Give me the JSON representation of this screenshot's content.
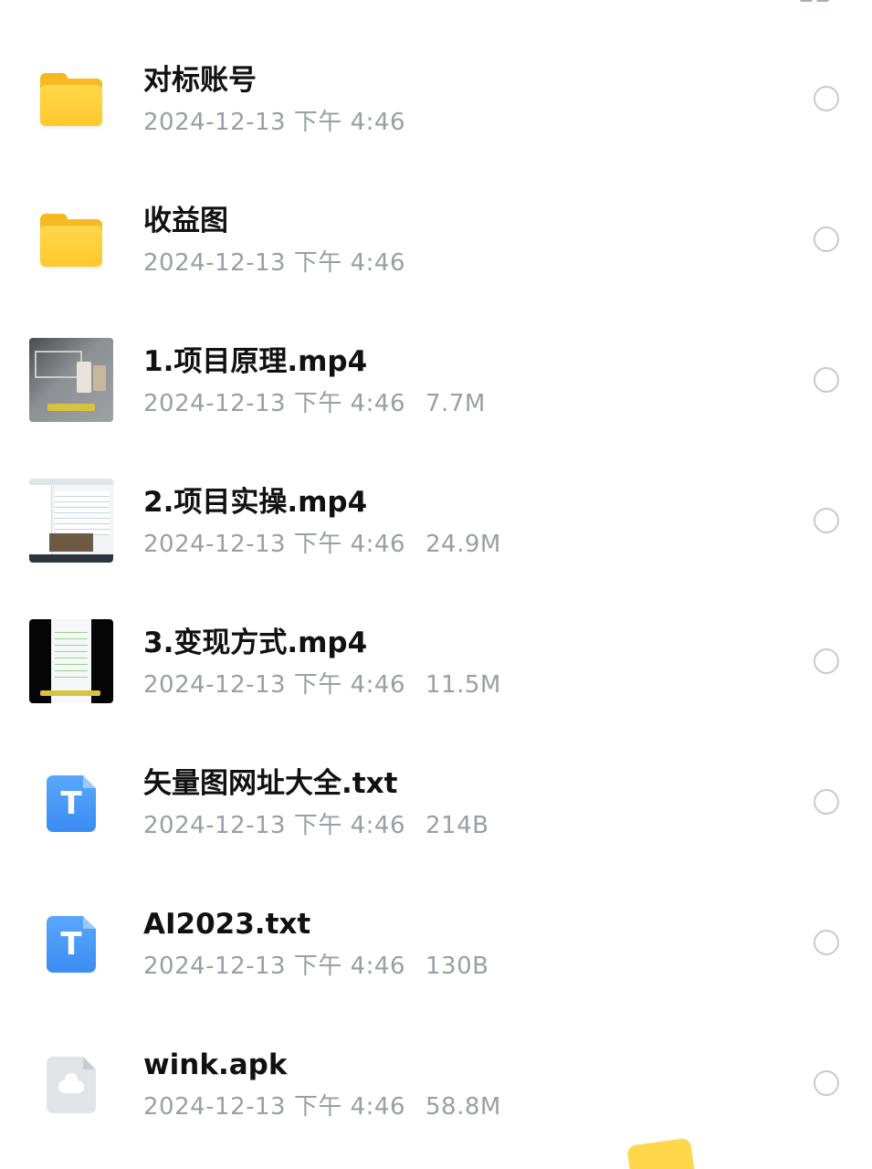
{
  "header": {
    "title": "",
    "view_toggle_icon": "grid-view-icon"
  },
  "files": [
    {
      "name": "对标账号",
      "date": "2024-12-13 下午 4:46",
      "size": "",
      "type": "folder",
      "icon": "folder-icon"
    },
    {
      "name": "收益图",
      "date": "2024-12-13 下午 4:46",
      "size": "",
      "type": "folder",
      "icon": "folder-icon"
    },
    {
      "name": "1.项目原理.mp4",
      "date": "2024-12-13 下午 4:46",
      "size": "7.7M",
      "type": "video",
      "icon": "video-thumbnail"
    },
    {
      "name": "2.项目实操.mp4",
      "date": "2024-12-13 下午 4:46",
      "size": "24.9M",
      "type": "video",
      "icon": "video-thumbnail"
    },
    {
      "name": "3.变现方式.mp4",
      "date": "2024-12-13 下午 4:46",
      "size": "11.5M",
      "type": "video",
      "icon": "video-thumbnail"
    },
    {
      "name": "矢量图网址大全.txt",
      "date": "2024-12-13 下午 4:46",
      "size": "214B",
      "type": "text",
      "icon": "txt-file-icon",
      "glyph": "T"
    },
    {
      "name": "AI2023.txt",
      "date": "2024-12-13 下午 4:46",
      "size": "130B",
      "type": "text",
      "icon": "txt-file-icon",
      "glyph": "T"
    },
    {
      "name": "wink.apk",
      "date": "2024-12-13 下午 4:46",
      "size": "58.8M",
      "type": "apk",
      "icon": "cloud-file-icon"
    }
  ],
  "colors": {
    "folder": "#fec92d",
    "txt_icon": "#3a8cf3",
    "meta_text": "#9a9ea6",
    "name_text": "#111111",
    "radio_border": "#c7cace"
  }
}
